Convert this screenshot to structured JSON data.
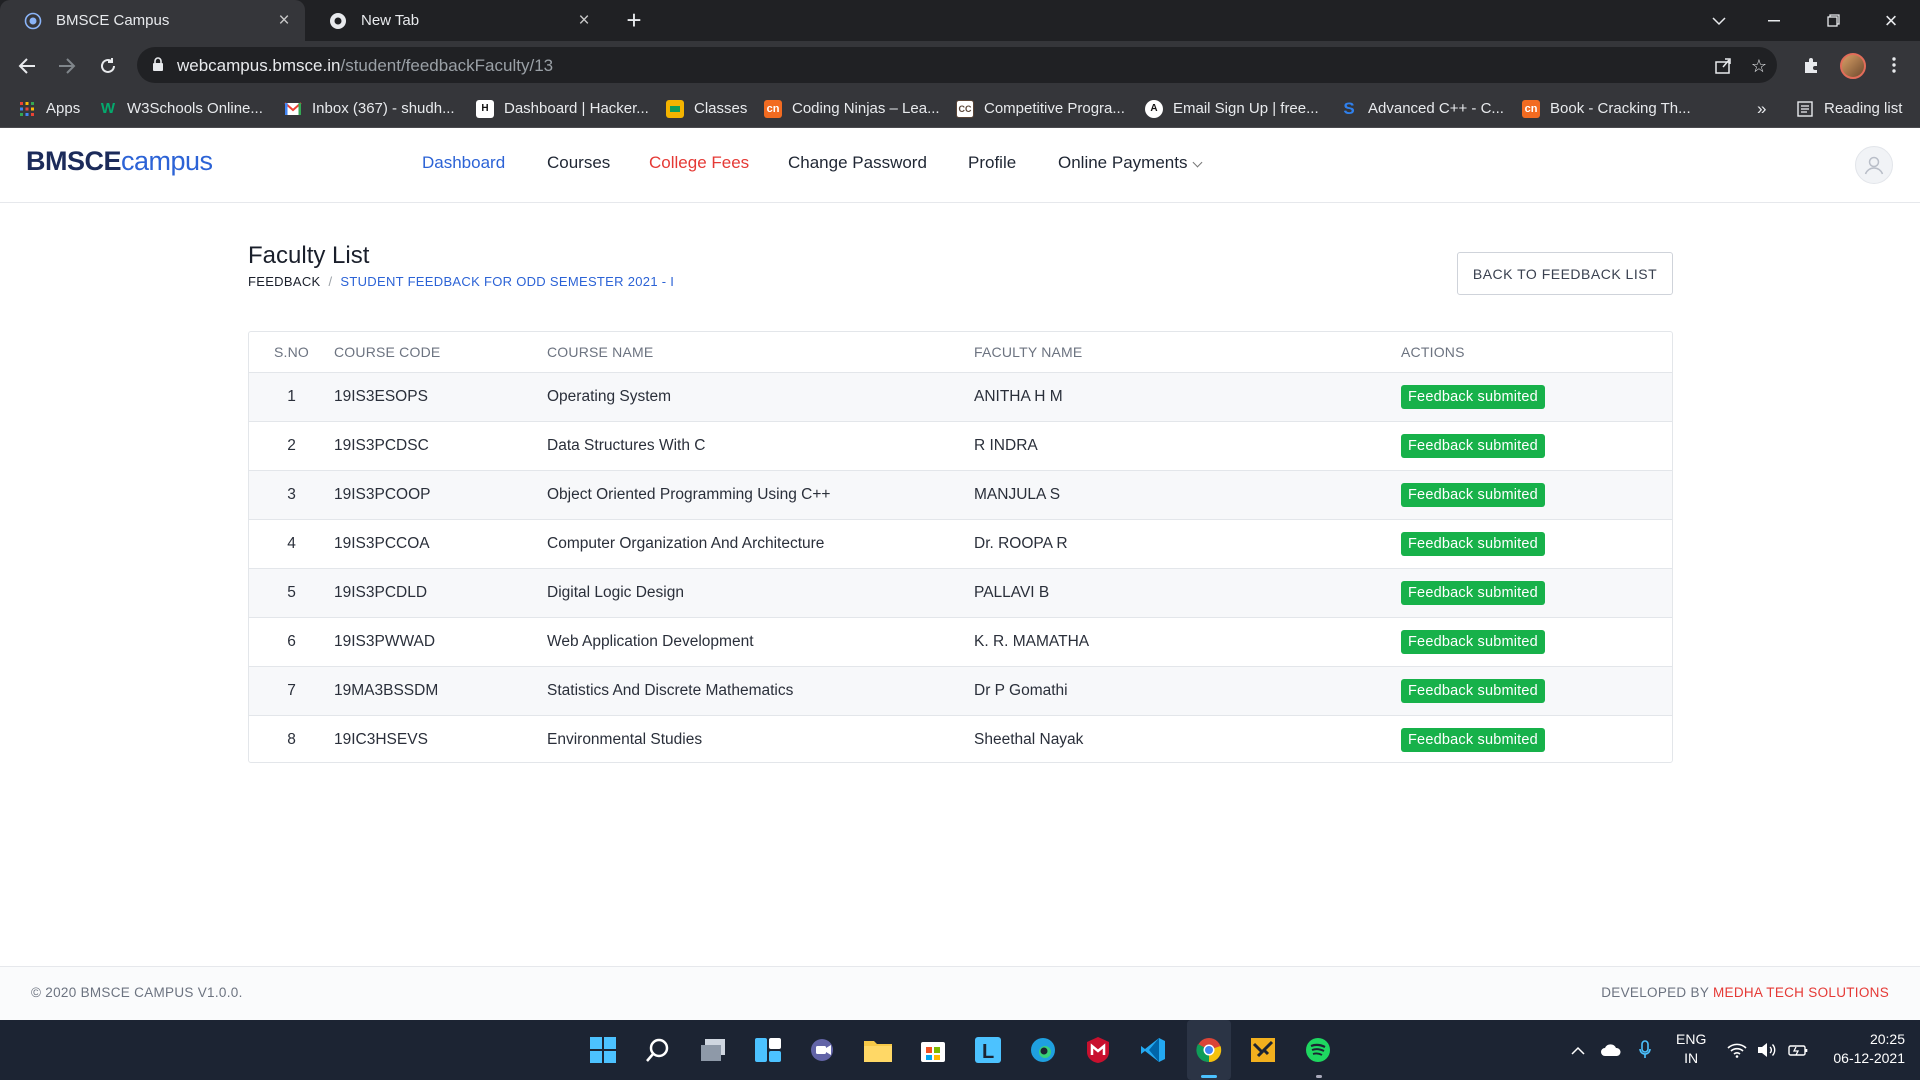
{
  "browser": {
    "tabs": [
      {
        "title": "BMSCE Campus",
        "icon": "globe-icon",
        "active": true
      },
      {
        "title": "New Tab",
        "icon": "chrome-icon",
        "active": false
      }
    ],
    "url_host": "webcampus.bmsce.in",
    "url_path": "/student/feedbackFaculty/13",
    "bookmarks": [
      {
        "label": "Apps",
        "icon": "apps-grid-icon",
        "color": "#4285f4"
      },
      {
        "label": "W3Schools Online...",
        "icon": "w3schools-icon",
        "color": "#04aa6d"
      },
      {
        "label": "Inbox (367) - shudh...",
        "icon": "gmail-icon",
        "color": "#ea4335"
      },
      {
        "label": "Dashboard | Hacker...",
        "icon": "hackerrank-icon",
        "color": "#111111"
      },
      {
        "label": "Classes",
        "icon": "classroom-icon",
        "color": "#f4b400"
      },
      {
        "label": "Coding Ninjas – Lea...",
        "icon": "codingninjas-icon",
        "color": "#f26b21"
      },
      {
        "label": "Competitive Progra...",
        "icon": "codechef-icon",
        "color": "#5b4638"
      },
      {
        "label": "Email Sign Up | free...",
        "icon": "email-icon",
        "color": "#111111"
      },
      {
        "label": "Advanced C++ - C...",
        "icon": "s-icon",
        "color": "#2f80ed"
      },
      {
        "label": "Book - Cracking Th...",
        "icon": "book-icon",
        "color": "#f26b21"
      }
    ],
    "more_bookmarks": "»",
    "reading_list": "Reading list"
  },
  "site": {
    "logo_bold": "BMSCE",
    "logo_light": "campus",
    "nav": [
      "Dashboard",
      "Courses",
      "College Fees",
      "Change Password",
      "Profile",
      "Online Payments"
    ]
  },
  "page": {
    "title": "Faculty List",
    "breadcrumb_root": "FEEDBACK",
    "breadcrumb_sep": "/",
    "breadcrumb_current": "STUDENT FEEDBACK FOR ODD SEMESTER 2021 - I",
    "back_button": "BACK TO FEEDBACK LIST"
  },
  "table": {
    "headers": [
      "S.NO",
      "COURSE CODE",
      "COURSE NAME",
      "FACULTY NAME",
      "ACTIONS"
    ],
    "rows": [
      {
        "sno": "1",
        "code": "19IS3ESOPS",
        "course": "Operating System",
        "faculty": "ANITHA H M",
        "action": "Feedback submited"
      },
      {
        "sno": "2",
        "code": "19IS3PCDSC",
        "course": "Data Structures With C",
        "faculty": "R INDRA",
        "action": "Feedback submited"
      },
      {
        "sno": "3",
        "code": "19IS3PCOOP",
        "course": "Object Oriented Programming Using C++",
        "faculty": "MANJULA S",
        "action": "Feedback submited"
      },
      {
        "sno": "4",
        "code": "19IS3PCCOA",
        "course": "Computer Organization And Architecture",
        "faculty": "Dr. ROOPA R",
        "action": "Feedback submited"
      },
      {
        "sno": "5",
        "code": "19IS3PCDLD",
        "course": "Digital Logic Design",
        "faculty": "PALLAVI B",
        "action": "Feedback submited"
      },
      {
        "sno": "6",
        "code": "19IS3PWWAD",
        "course": "Web Application Development",
        "faculty": "K. R. MAMATHA",
        "action": "Feedback submited"
      },
      {
        "sno": "7",
        "code": "19MA3BSSDM",
        "course": "Statistics And Discrete Mathematics",
        "faculty": "Dr P Gomathi",
        "action": "Feedback submited"
      },
      {
        "sno": "8",
        "code": "19IC3HSEVS",
        "course": "Environmental Studies",
        "faculty": "Sheethal Nayak",
        "action": "Feedback submited"
      }
    ]
  },
  "footer": {
    "copyright": "© 2020 BMSCE CAMPUS V1.0.0.",
    "developed_by": "DEVELOPED BY",
    "developer": "MEDHA TECH SOLUTIONS"
  },
  "taskbar": {
    "lang_top": "ENG",
    "lang_bottom": "IN",
    "time": "20:25",
    "date": "06-12-2021"
  },
  "colors": {
    "accent_blue": "#2c63d6",
    "accent_red": "#e53935",
    "badge_green": "#17b14a"
  }
}
